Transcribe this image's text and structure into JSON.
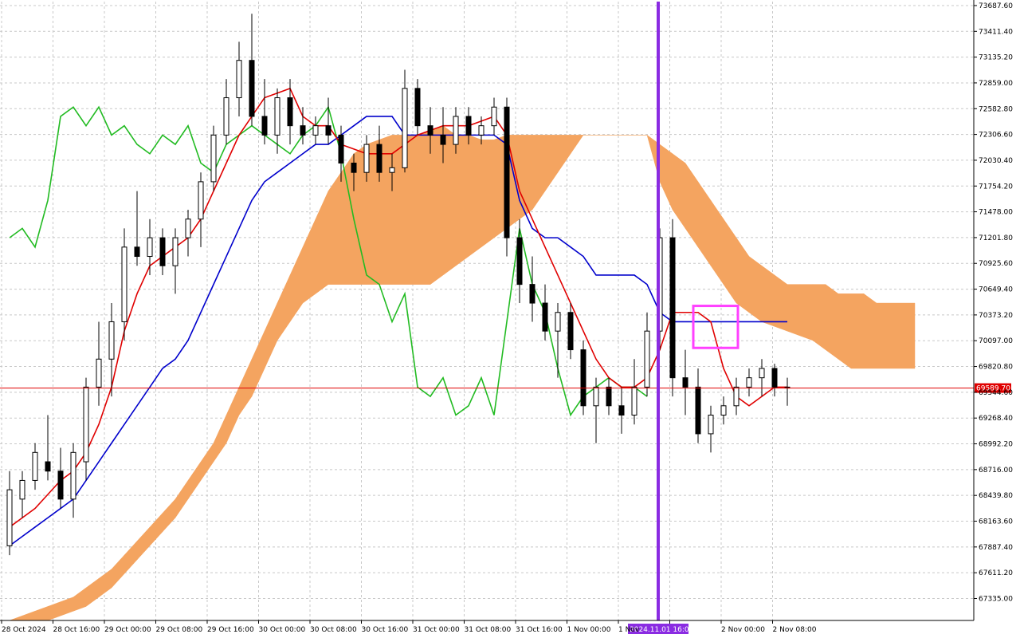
{
  "colors": {
    "background": "#ffffff",
    "grid": "#c8c8c8",
    "candle_body_up": "#ffffff",
    "candle_body_down": "#000000",
    "candle_outline": "#000000",
    "tenkan": "#e00000",
    "kijun": "#0000cc",
    "chikou": "#22bb22",
    "kumo_bull": "#f4a460",
    "kumo_bear": "#d8b8d8",
    "current_price_line": "#e00000",
    "current_price_label_bg": "#e00000",
    "current_price_label_text": "#ffffff",
    "vertical_marker": "#8a2be2",
    "time_label_bg": "#8a2be2",
    "time_label_text": "#ffffff",
    "highlight_box": "#ff40ff"
  },
  "chart_data": {
    "type": "candlestick-ichimoku",
    "grid": true,
    "ylim": [
      67100,
      73730
    ],
    "y_ticks": [
      "73687.60",
      "73411.40",
      "73135.20",
      "72859.00",
      "72582.80",
      "72306.60",
      "72030.40",
      "71754.20",
      "71478.00",
      "71201.80",
      "70925.60",
      "70649.40",
      "70373.20",
      "70097.00",
      "69820.80",
      "69544.60",
      "69268.40",
      "68992.20",
      "68716.00",
      "68439.80",
      "68163.60",
      "67887.40",
      "67611.20",
      "67335.00"
    ],
    "x_ticks": [
      "28 Oct 2024",
      "28 Oct 16:00",
      "29 Oct 00:00",
      "29 Oct 08:00",
      "29 Oct 16:00",
      "30 Oct 00:00",
      "30 Oct 08:00",
      "30 Oct 16:00",
      "31 Oct 00:00",
      "31 Oct 08:00",
      "31 Oct 16:00",
      "1 Nov 00:00",
      "1 Nov",
      "",
      "2 Nov 00:00",
      "2 Nov 08:00"
    ],
    "current_price": 69589.7,
    "current_price_label": "69589.70",
    "marker_time_label": "2024.11.01 16:00",
    "marker_bar_index": 51,
    "highlight_box": {
      "bar_start": 54,
      "bar_end": 57,
      "price_top": 70470,
      "price_bottom": 70020
    },
    "candles": [
      {
        "o": 67900,
        "h": 68700,
        "l": 67800,
        "c": 68500
      },
      {
        "o": 68400,
        "h": 68700,
        "l": 68200,
        "c": 68600
      },
      {
        "o": 68600,
        "h": 69000,
        "l": 68500,
        "c": 68900
      },
      {
        "o": 68800,
        "h": 69300,
        "l": 68600,
        "c": 68700
      },
      {
        "o": 68700,
        "h": 68950,
        "l": 68300,
        "c": 68400
      },
      {
        "o": 68400,
        "h": 69000,
        "l": 68200,
        "c": 68900
      },
      {
        "o": 68800,
        "h": 69700,
        "l": 68600,
        "c": 69600
      },
      {
        "o": 69600,
        "h": 70300,
        "l": 69400,
        "c": 69900
      },
      {
        "o": 69900,
        "h": 70500,
        "l": 69500,
        "c": 70300
      },
      {
        "o": 70300,
        "h": 71300,
        "l": 70100,
        "c": 71100
      },
      {
        "o": 71100,
        "h": 71700,
        "l": 70900,
        "c": 71000
      },
      {
        "o": 71000,
        "h": 71400,
        "l": 70800,
        "c": 71200
      },
      {
        "o": 71200,
        "h": 71300,
        "l": 70800,
        "c": 70900
      },
      {
        "o": 70900,
        "h": 71300,
        "l": 70600,
        "c": 71200
      },
      {
        "o": 71200,
        "h": 71500,
        "l": 71000,
        "c": 71400
      },
      {
        "o": 71400,
        "h": 71900,
        "l": 71100,
        "c": 71800
      },
      {
        "o": 71800,
        "h": 72400,
        "l": 71700,
        "c": 72300
      },
      {
        "o": 72300,
        "h": 72900,
        "l": 72200,
        "c": 72700
      },
      {
        "o": 72700,
        "h": 73300,
        "l": 72500,
        "c": 73100
      },
      {
        "o": 73100,
        "h": 73600,
        "l": 72400,
        "c": 72500
      },
      {
        "o": 72500,
        "h": 72900,
        "l": 72200,
        "c": 72300
      },
      {
        "o": 72300,
        "h": 72800,
        "l": 72100,
        "c": 72700
      },
      {
        "o": 72700,
        "h": 72900,
        "l": 72200,
        "c": 72400
      },
      {
        "o": 72400,
        "h": 72600,
        "l": 72200,
        "c": 72300
      },
      {
        "o": 72300,
        "h": 72500,
        "l": 72200,
        "c": 72400
      },
      {
        "o": 72400,
        "h": 72700,
        "l": 72200,
        "c": 72300
      },
      {
        "o": 72300,
        "h": 72400,
        "l": 71800,
        "c": 72000
      },
      {
        "o": 72000,
        "h": 72100,
        "l": 71700,
        "c": 71900
      },
      {
        "o": 71900,
        "h": 72300,
        "l": 71800,
        "c": 72200
      },
      {
        "o": 72200,
        "h": 72400,
        "l": 71800,
        "c": 71900
      },
      {
        "o": 71900,
        "h": 72100,
        "l": 71700,
        "c": 71950
      },
      {
        "o": 71950,
        "h": 73000,
        "l": 71900,
        "c": 72800
      },
      {
        "o": 72800,
        "h": 72900,
        "l": 72300,
        "c": 72400
      },
      {
        "o": 72400,
        "h": 72600,
        "l": 72100,
        "c": 72300
      },
      {
        "o": 72300,
        "h": 72600,
        "l": 72000,
        "c": 72200
      },
      {
        "o": 72200,
        "h": 72600,
        "l": 72100,
        "c": 72500
      },
      {
        "o": 72500,
        "h": 72600,
        "l": 72200,
        "c": 72300
      },
      {
        "o": 72300,
        "h": 72500,
        "l": 72200,
        "c": 72400
      },
      {
        "o": 72400,
        "h": 72700,
        "l": 72300,
        "c": 72600
      },
      {
        "o": 72600,
        "h": 72700,
        "l": 71000,
        "c": 71200
      },
      {
        "o": 71200,
        "h": 71400,
        "l": 70500,
        "c": 70700
      },
      {
        "o": 70700,
        "h": 71000,
        "l": 70300,
        "c": 70500
      },
      {
        "o": 70500,
        "h": 70700,
        "l": 70100,
        "c": 70200
      },
      {
        "o": 70200,
        "h": 70500,
        "l": 69700,
        "c": 70400
      },
      {
        "o": 70400,
        "h": 70500,
        "l": 69900,
        "c": 70000
      },
      {
        "o": 70000,
        "h": 70100,
        "l": 69300,
        "c": 69400
      },
      {
        "o": 69400,
        "h": 69700,
        "l": 69000,
        "c": 69600
      },
      {
        "o": 69600,
        "h": 69700,
        "l": 69300,
        "c": 69400
      },
      {
        "o": 69400,
        "h": 69600,
        "l": 69100,
        "c": 69300
      },
      {
        "o": 69300,
        "h": 69900,
        "l": 69200,
        "c": 69600
      },
      {
        "o": 69600,
        "h": 70400,
        "l": 69500,
        "c": 70200
      },
      {
        "o": 70200,
        "h": 71300,
        "l": 70000,
        "c": 71200
      },
      {
        "o": 71200,
        "h": 71400,
        "l": 69500,
        "c": 69700
      },
      {
        "o": 69700,
        "h": 70000,
        "l": 69300,
        "c": 69600
      },
      {
        "o": 69600,
        "h": 69800,
        "l": 69000,
        "c": 69100
      },
      {
        "o": 69100,
        "h": 69400,
        "l": 68900,
        "c": 69300
      },
      {
        "o": 69300,
        "h": 69500,
        "l": 69200,
        "c": 69400
      },
      {
        "o": 69400,
        "h": 69700,
        "l": 69300,
        "c": 69600
      },
      {
        "o": 69600,
        "h": 69800,
        "l": 69500,
        "c": 69700
      },
      {
        "o": 69700,
        "h": 69900,
        "l": 69500,
        "c": 69800
      },
      {
        "o": 69800,
        "h": 69850,
        "l": 69500,
        "c": 69600
      },
      {
        "o": 69600,
        "h": 69700,
        "l": 69400,
        "c": 69590
      }
    ],
    "tenkan": [
      68100,
      68200,
      68300,
      68450,
      68600,
      68700,
      68900,
      69200,
      69600,
      70200,
      70600,
      70900,
      71000,
      71100,
      71200,
      71400,
      71700,
      72000,
      72300,
      72500,
      72700,
      72750,
      72800,
      72500,
      72400,
      72400,
      72200,
      72150,
      72100,
      72100,
      72100,
      72200,
      72300,
      72350,
      72400,
      72400,
      72400,
      72450,
      72500,
      72300,
      71700,
      71400,
      71100,
      70800,
      70500,
      70200,
      69900,
      69700,
      69600,
      69600,
      69700,
      70000,
      70400,
      70400,
      70400,
      70300,
      69800,
      69500,
      69400,
      69500,
      69600,
      69600
    ],
    "kijun": [
      67900,
      68000,
      68100,
      68200,
      68300,
      68400,
      68600,
      68800,
      69000,
      69200,
      69400,
      69600,
      69800,
      69900,
      70100,
      70400,
      70700,
      71000,
      71300,
      71600,
      71800,
      71900,
      72000,
      72100,
      72200,
      72200,
      72300,
      72400,
      72500,
      72500,
      72500,
      72300,
      72300,
      72300,
      72300,
      72300,
      72300,
      72300,
      72300,
      72200,
      71600,
      71300,
      71200,
      71200,
      71100,
      71000,
      70800,
      70800,
      70800,
      70800,
      70700,
      70400,
      70300,
      70300,
      70300,
      70300,
      70300,
      70300,
      70300,
      70300,
      70300,
      70300
    ],
    "chikou": [
      71200,
      71300,
      71100,
      71600,
      72500,
      72600,
      72400,
      72600,
      72300,
      72400,
      72200,
      72100,
      72300,
      72200,
      72400,
      72000,
      71900,
      72200,
      72300,
      72400,
      72300,
      72200,
      72100,
      72300,
      72400,
      72600,
      72100,
      71400,
      70800,
      70700,
      70300,
      70600,
      69600,
      69500,
      69700,
      69300,
      69400,
      69700,
      69300,
      70300,
      71300,
      70700,
      70400,
      69800,
      69300,
      69500,
      69600,
      69700,
      69600,
      69600,
      69500
    ],
    "kumo_upper": [
      67100,
      67150,
      67200,
      67250,
      67300,
      67350,
      67450,
      67550,
      67650,
      67800,
      67950,
      68100,
      68250,
      68400,
      68600,
      68800,
      69000,
      69300,
      69600,
      69900,
      70200,
      70500,
      70800,
      71100,
      71400,
      71700,
      71900,
      72100,
      72200,
      72250,
      72300,
      72300,
      72300,
      72350,
      72400,
      72300,
      72300,
      72250,
      72250,
      72300,
      72300,
      72300,
      72300,
      72300,
      72300,
      72300,
      72300,
      72300,
      72300,
      72300,
      72300,
      72200,
      72100,
      72000,
      71800,
      71600,
      71400,
      71200,
      71000,
      70900,
      70800,
      70700,
      70700,
      70700,
      70700,
      70600,
      70600,
      70600,
      70500,
      70500,
      70500,
      70500
    ],
    "kumo_lower": [
      67100,
      67100,
      67100,
      67100,
      67150,
      67200,
      67250,
      67350,
      67450,
      67600,
      67750,
      67900,
      68050,
      68200,
      68400,
      68600,
      68800,
      69000,
      69300,
      69500,
      69800,
      70100,
      70300,
      70500,
      70600,
      70700,
      70700,
      70700,
      70700,
      70700,
      70700,
      70700,
      70700,
      70700,
      70800,
      70900,
      71000,
      71100,
      71200,
      71300,
      71400,
      71500,
      71700,
      71900,
      72100,
      72300,
      72300,
      72300,
      72300,
      72300,
      72300,
      71800,
      71500,
      71300,
      71100,
      70900,
      70700,
      70500,
      70400,
      70300,
      70250,
      70200,
      70150,
      70100,
      70000,
      69900,
      69800,
      69800,
      69800,
      69800,
      69800,
      69800
    ]
  }
}
